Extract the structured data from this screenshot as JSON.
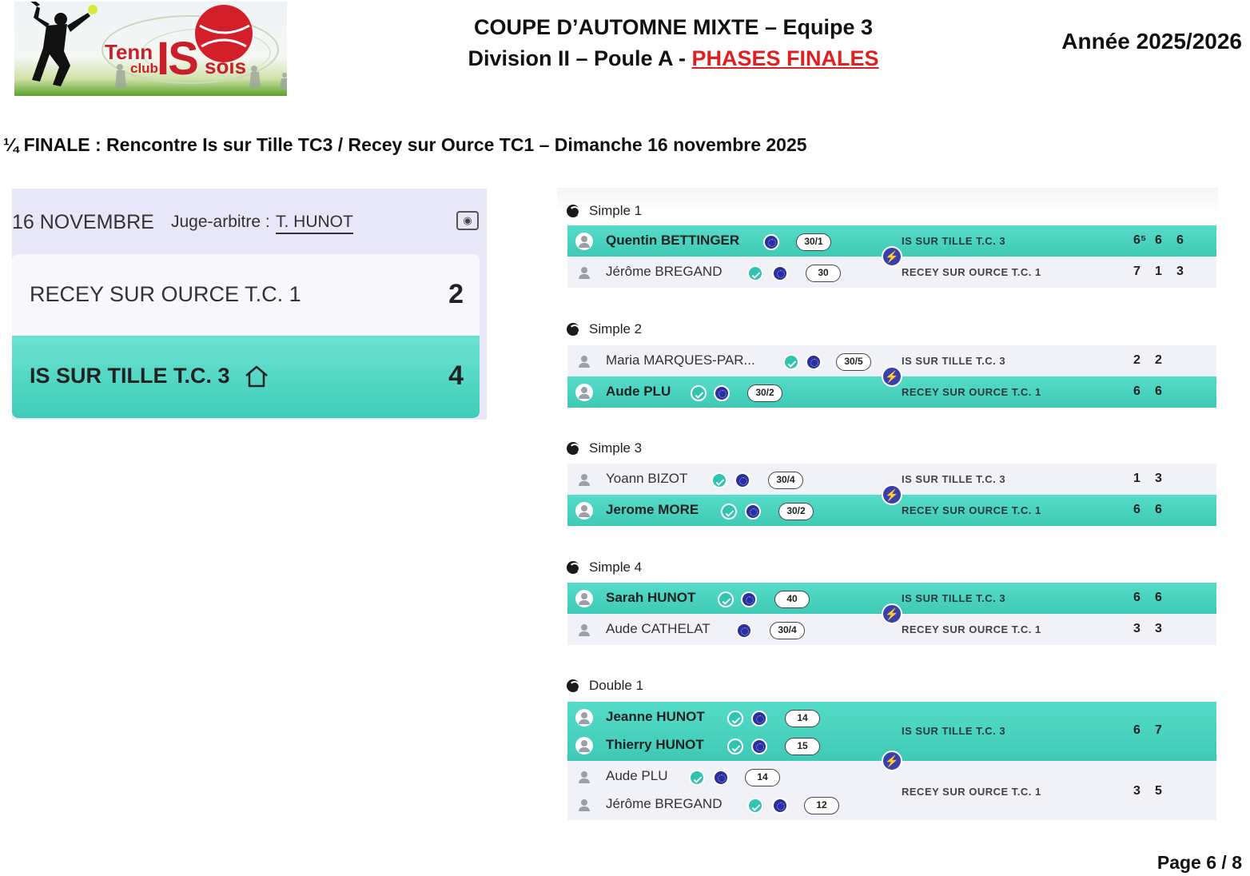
{
  "logo": {
    "text_tenn": "Tenn",
    "text_club": "club",
    "text_is": "IS",
    "text_sois": "sois"
  },
  "header": {
    "title_line1": "COUPE D’AUTOMNE MIXTE – Equipe 3",
    "title_line2_prefix": "Division II – Poule A - ",
    "title_line2_highlight": "PHASES FINALES",
    "season": "Année 2025/2026",
    "highlight_color": "#e02020"
  },
  "section_title": "¼ FINALE : Rencontre Is sur Tille TC3 / Recey sur Ource TC1 – Dimanche 16 novembre 2025",
  "scoreboard": {
    "date": "16 NOVEMBRE",
    "judge_label": "Juge-arbitre :",
    "judge_name": "T. HUNOT",
    "teams": [
      {
        "name": "RECEY SUR OURCE T.C. 1",
        "score": "2"
      },
      {
        "name": "IS SUR TILLE T.C. 3",
        "score": "4",
        "home_icon": "home-icon"
      }
    ],
    "accent_color": "#4fd8c4"
  },
  "matches": [
    {
      "label": "Simple 1",
      "players": [
        {
          "name": "Quentin BETTINGER",
          "rank": "30/1",
          "club": "IS SUR TILLE T.C. 3",
          "sets": [
            "6⁵",
            "6",
            "6"
          ],
          "winner": true
        },
        {
          "name": "Jérôme BREGAND",
          "rank": "30",
          "club": "RECEY SUR OURCE T.C. 1",
          "sets": [
            "7",
            "1",
            "3"
          ],
          "winner": false
        }
      ]
    },
    {
      "label": "Simple 2",
      "players": [
        {
          "name": "Maria MARQUES-PAR...",
          "rank": "30/5",
          "club": "IS SUR TILLE T.C. 3",
          "sets": [
            "2",
            "2"
          ],
          "winner": false
        },
        {
          "name": "Aude PLU",
          "rank": "30/2",
          "club": "RECEY SUR OURCE T.C. 1",
          "sets": [
            "6",
            "6"
          ],
          "winner": true
        }
      ]
    },
    {
      "label": "Simple 3",
      "players": [
        {
          "name": "Yoann BIZOT",
          "rank": "30/4",
          "club": "IS SUR TILLE T.C. 3",
          "sets": [
            "1",
            "3"
          ],
          "winner": false
        },
        {
          "name": "Jerome MORE",
          "rank": "30/2",
          "club": "RECEY SUR OURCE T.C. 1",
          "sets": [
            "6",
            "6"
          ],
          "winner": true
        }
      ]
    },
    {
      "label": "Simple 4",
      "players": [
        {
          "name": "Sarah HUNOT",
          "rank": "40",
          "club": "IS SUR TILLE T.C. 3",
          "sets": [
            "6",
            "6"
          ],
          "winner": true
        },
        {
          "name": "Aude CATHELAT",
          "rank": "30/4",
          "club": "RECEY SUR OURCE T.C. 1",
          "sets": [
            "3",
            "3"
          ],
          "winner": false
        }
      ]
    },
    {
      "label": "Double 1",
      "pairs": [
        {
          "players": [
            {
              "name": "Jeanne HUNOT",
              "rank": "14"
            },
            {
              "name": "Thierry HUNOT",
              "rank": "15"
            }
          ],
          "club": "IS SUR TILLE T.C. 3",
          "sets": [
            "6",
            "7"
          ],
          "winner": true
        },
        {
          "players": [
            {
              "name": "Aude PLU",
              "rank": "14"
            },
            {
              "name": "Jérôme BREGAND",
              "rank": "12"
            }
          ],
          "club": "RECEY SUR OURCE T.C. 1",
          "sets": [
            "3",
            "5"
          ],
          "winner": false
        }
      ]
    }
  ],
  "page": "Page 6 / 8"
}
